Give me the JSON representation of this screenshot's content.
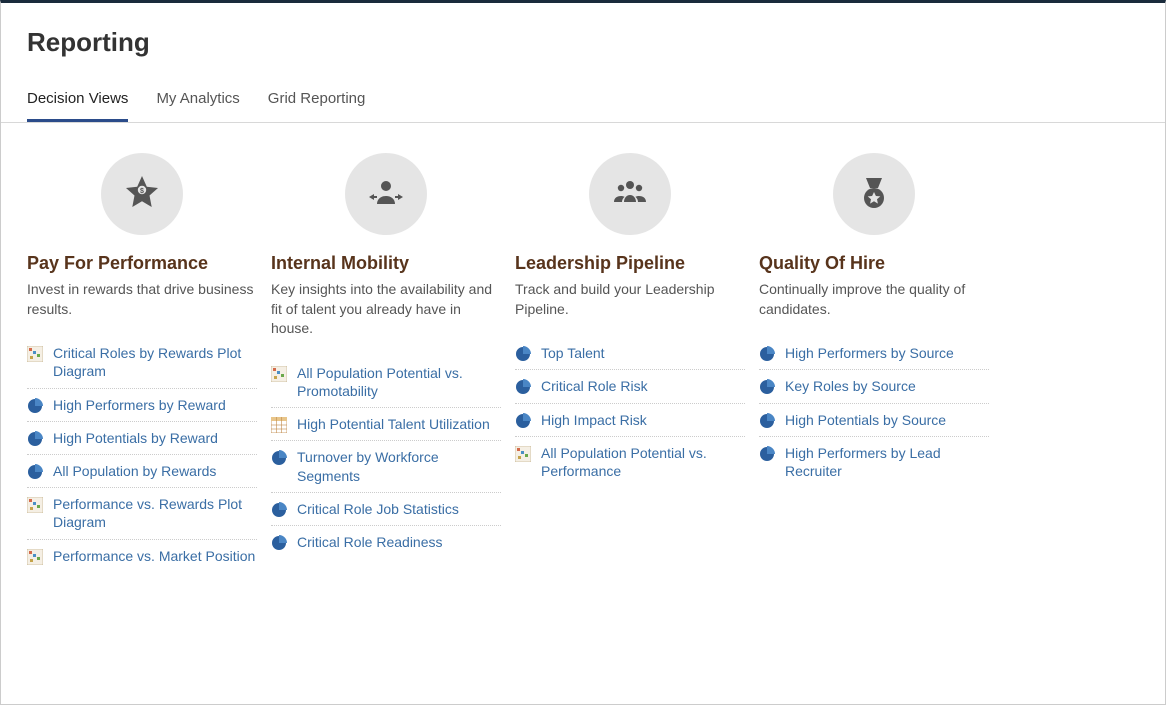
{
  "page_title": "Reporting",
  "tabs": [
    {
      "label": "Decision Views",
      "active": true
    },
    {
      "label": "My Analytics",
      "active": false
    },
    {
      "label": "Grid Reporting",
      "active": false
    }
  ],
  "categories": [
    {
      "icon": "star-dollar",
      "title": "Pay For Performance",
      "description": "Invest in rewards that drive business results.",
      "links": [
        {
          "icon": "grid",
          "text": "Critical Roles by Rewards Plot Diagram"
        },
        {
          "icon": "pie",
          "text": "High Performers by Reward"
        },
        {
          "icon": "pie",
          "text": "High Potentials by Reward"
        },
        {
          "icon": "pie",
          "text": "All Population by Rewards"
        },
        {
          "icon": "grid",
          "text": "Performance vs. Rewards Plot Diagram"
        },
        {
          "icon": "grid",
          "text": "Performance vs. Market Position"
        }
      ]
    },
    {
      "icon": "person-arrows",
      "title": "Internal Mobility",
      "description": "Key insights into the availability and fit of talent you already have in house.",
      "links": [
        {
          "icon": "grid",
          "text": "All Population Potential vs. Promotability"
        },
        {
          "icon": "table",
          "text": "High Potential Talent Utilization"
        },
        {
          "icon": "pie",
          "text": "Turnover by Workforce Segments"
        },
        {
          "icon": "pie",
          "text": "Critical Role Job Statistics"
        },
        {
          "icon": "pie",
          "text": "Critical Role Readiness"
        }
      ]
    },
    {
      "icon": "people-group",
      "title": "Leadership Pipeline",
      "description": "Track and build your Leadership Pipeline.",
      "links": [
        {
          "icon": "pie",
          "text": "Top Talent"
        },
        {
          "icon": "pie",
          "text": "Critical Role Risk"
        },
        {
          "icon": "pie",
          "text": "High Impact Risk"
        },
        {
          "icon": "grid",
          "text": "All Population Potential vs. Performance"
        }
      ]
    },
    {
      "icon": "medal",
      "title": "Quality Of Hire",
      "description": "Continually improve the quality of candidates.",
      "links": [
        {
          "icon": "pie",
          "text": "High Performers by Source"
        },
        {
          "icon": "pie",
          "text": "Key Roles by Source"
        },
        {
          "icon": "pie",
          "text": "High Potentials by Source"
        },
        {
          "icon": "pie",
          "text": "High Performers by Lead Recruiter"
        }
      ]
    }
  ]
}
